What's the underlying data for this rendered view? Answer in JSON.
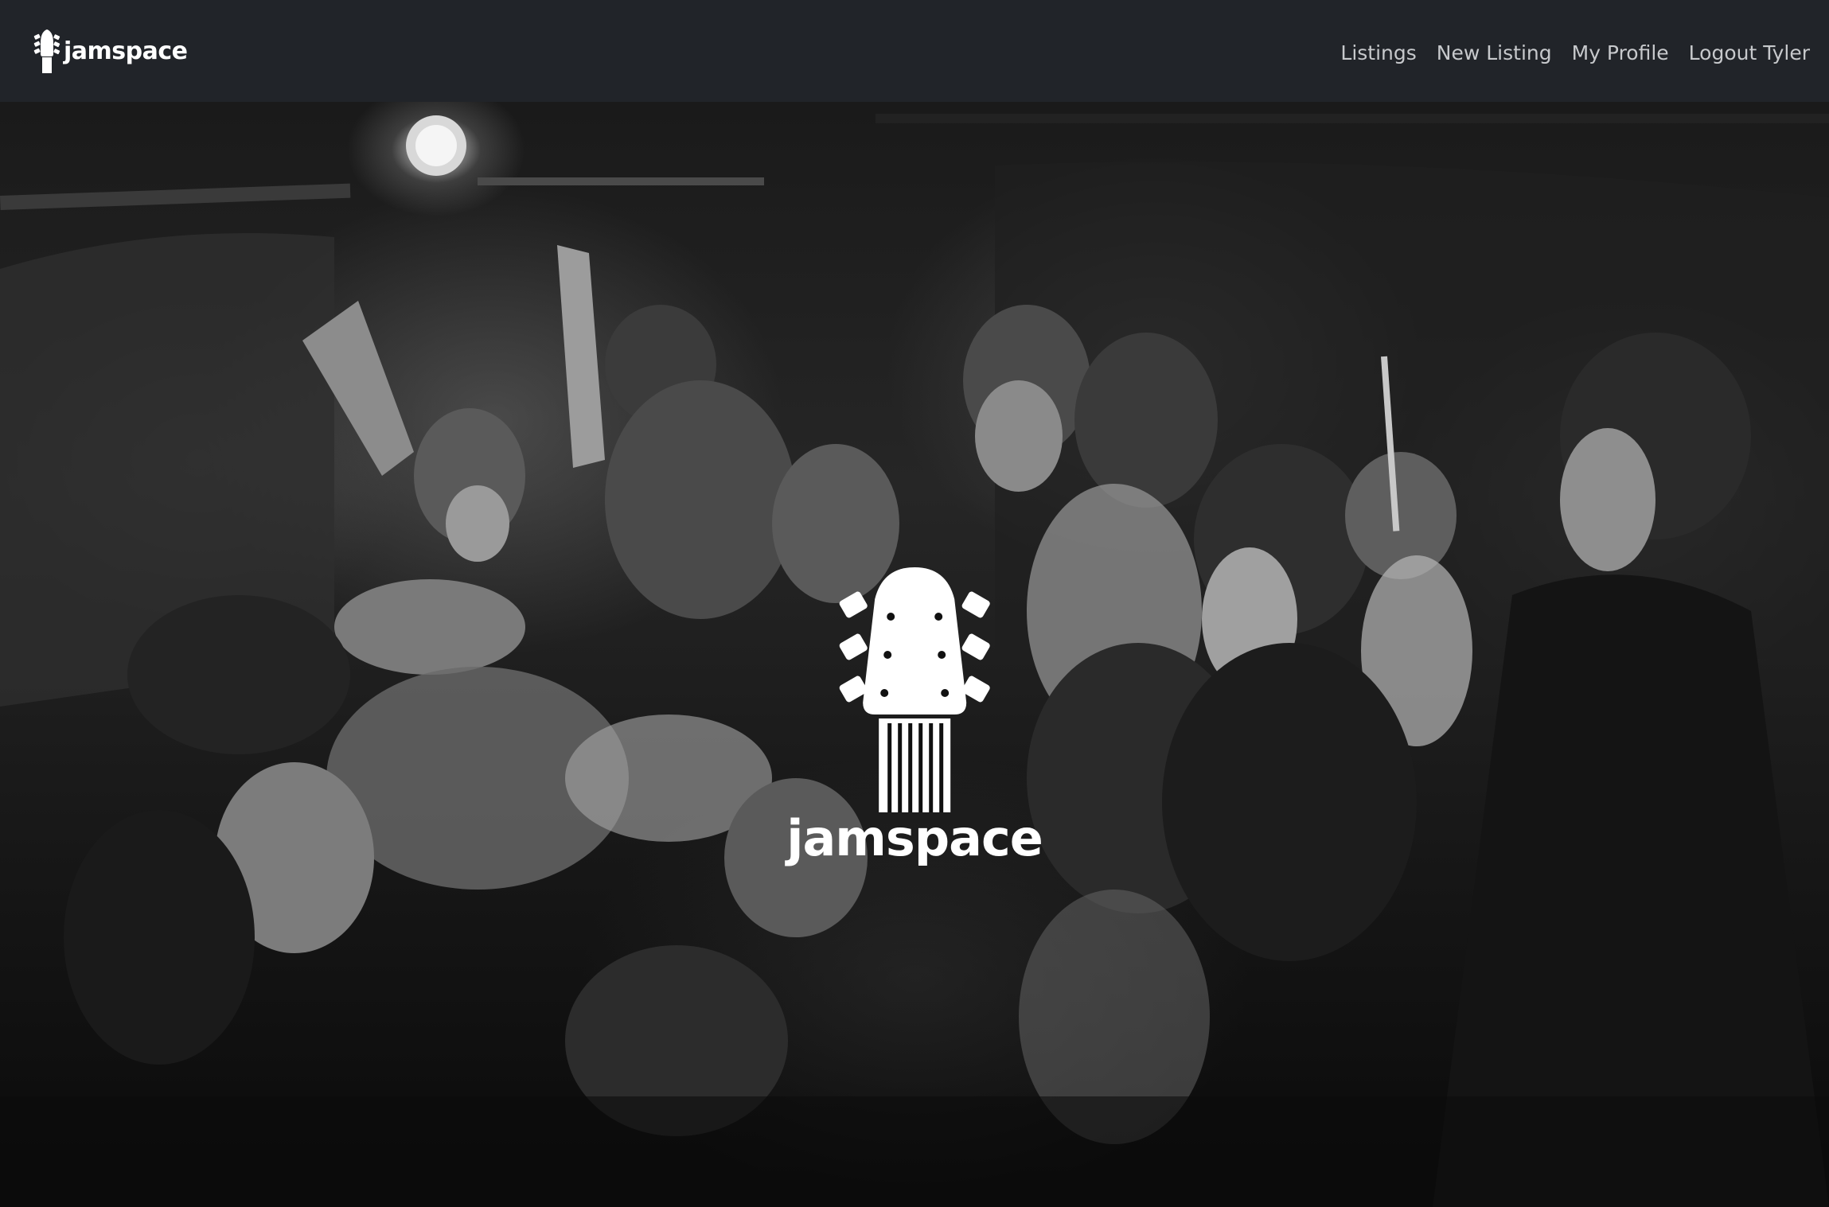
{
  "navbar": {
    "brand": "jamspace",
    "links": [
      "Listings",
      "New Listing",
      "My Profile",
      "Logout Tyler"
    ]
  },
  "hero": {
    "image_description_icon": "concert-crowd-photo",
    "logo_text": "jamspace",
    "logo_icon": "guitar-headstock-icon"
  },
  "colors": {
    "navbar_bg": "#212429",
    "nav_link": "#c7c9cc",
    "logo": "#ffffff"
  }
}
